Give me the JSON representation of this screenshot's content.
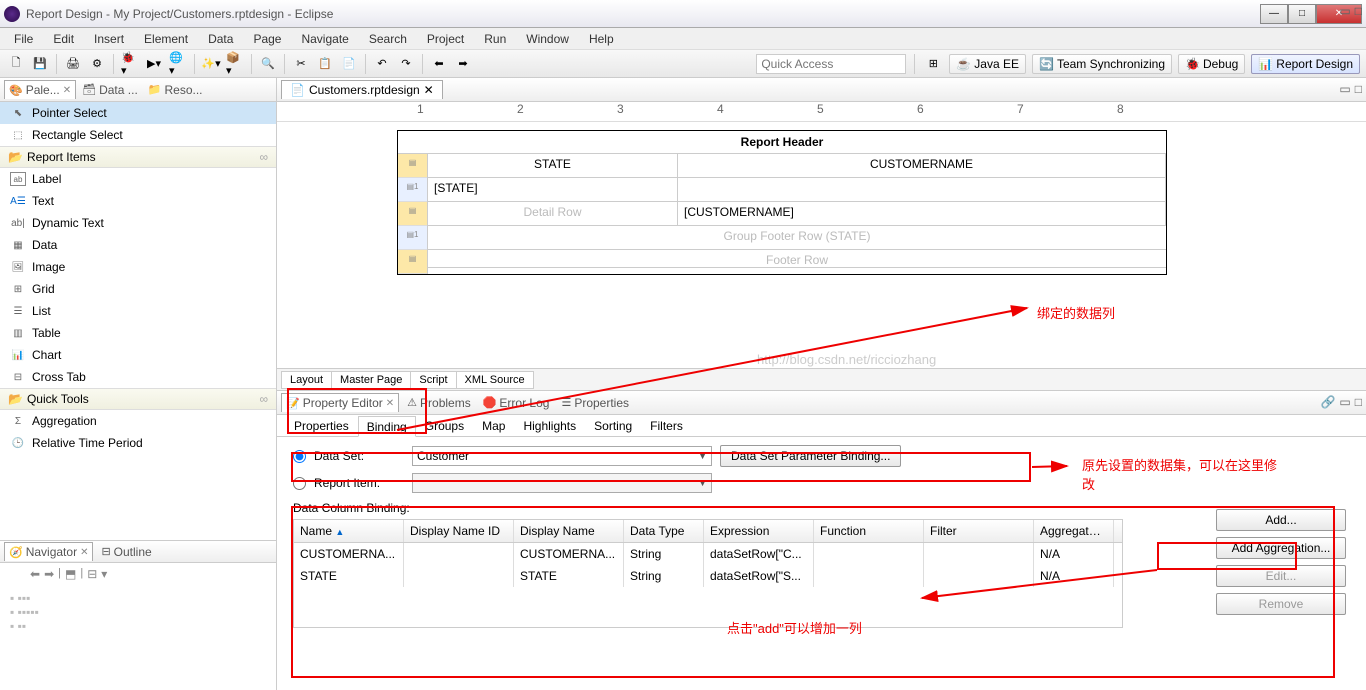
{
  "window": {
    "title": "Report Design - My Project/Customers.rptdesign - Eclipse"
  },
  "menu": [
    "File",
    "Edit",
    "Insert",
    "Element",
    "Data",
    "Page",
    "Navigate",
    "Search",
    "Project",
    "Run",
    "Window",
    "Help"
  ],
  "quickaccess": {
    "placeholder": "Quick Access"
  },
  "perspectives": [
    "Java EE",
    "Team Synchronizing",
    "Debug",
    "Report Design"
  ],
  "leftviews": {
    "palette": "Pale...",
    "data": "Data ...",
    "resource": "Reso..."
  },
  "palette": {
    "pointer": "Pointer Select",
    "rectangle": "Rectangle Select",
    "groups": {
      "report": {
        "label": "Report Items",
        "items": [
          "Label",
          "Text",
          "Dynamic Text",
          "Data",
          "Image",
          "Grid",
          "List",
          "Table",
          "Chart",
          "Cross Tab"
        ]
      },
      "quick": {
        "label": "Quick Tools",
        "items": [
          "Aggregation",
          "Relative Time Period"
        ]
      }
    }
  },
  "navigator": {
    "nav": "Navigator",
    "outline": "Outline"
  },
  "editor": {
    "file": "Customers.rptdesign"
  },
  "report": {
    "header": "Report Header",
    "col1": "STATE",
    "col2": "CUSTOMERNAME",
    "state_expr": "[STATE]",
    "detail_label": "Detail Row",
    "cust_expr": "[CUSTOMERNAME]",
    "gfooter": "Group Footer Row (STATE)",
    "footer": "Footer Row"
  },
  "layouttabs": [
    "Layout",
    "Master Page",
    "Script",
    "XML Source"
  ],
  "watermark": "http://blog.csdn.net/ricciozhang",
  "propviews": {
    "editor": "Property Editor",
    "problems": "Problems",
    "errlog": "Error Log",
    "props": "Properties"
  },
  "subtabs": [
    "Properties",
    "Binding",
    "Groups",
    "Map",
    "Highlights",
    "Sorting",
    "Filters"
  ],
  "binding": {
    "dataset_label": "Data Set:",
    "dataset_value": "Customer",
    "reportitem_label": "Report Item:",
    "param_btn": "Data Set Parameter Binding...",
    "dcb_label": "Data Column Binding:",
    "headers": {
      "name": "Name",
      "dispid": "Display Name ID",
      "disp": "Display Name",
      "type": "Data Type",
      "expr": "Expression",
      "func": "Function",
      "filt": "Filter",
      "agg": "Aggregate ..."
    },
    "rows": [
      {
        "name": "CUSTOMERNA...",
        "dispid": "",
        "disp": "CUSTOMERNA...",
        "type": "String",
        "expr": "dataSetRow[\"C...",
        "func": "",
        "filt": "",
        "agg": "N/A"
      },
      {
        "name": "STATE",
        "dispid": "",
        "disp": "STATE",
        "type": "String",
        "expr": "dataSetRow[\"S...",
        "func": "",
        "filt": "",
        "agg": "N/A"
      }
    ],
    "btns": {
      "add": "Add...",
      "addagg": "Add Aggregation...",
      "edit": "Edit...",
      "remove": "Remove"
    }
  },
  "annotations": {
    "a1": "绑定的数据列",
    "a2": "原先设置的数据集，可以在这里修改",
    "a3": "点击\"add\"可以增加一列"
  },
  "ruler": [
    "1",
    "2",
    "3",
    "4",
    "5",
    "6",
    "7",
    "8"
  ]
}
